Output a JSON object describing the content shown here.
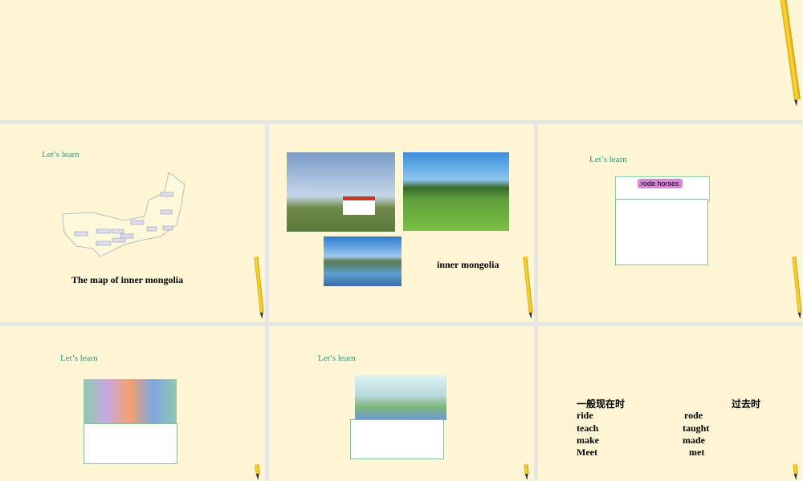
{
  "slides": [
    {
      "id": "slide-top"
    },
    {
      "lets_learn": "Let’s learn",
      "caption": "The map of inner mongolia"
    },
    {
      "caption": "inner mongolia"
    },
    {
      "lets_learn": "Let’s learn",
      "label": "rode horses"
    },
    {
      "lets_learn": "Let’s learn"
    },
    {
      "lets_learn": "Let’s learn"
    },
    {
      "table": {
        "header": [
          "一般现在时",
          "过去时"
        ],
        "rows": [
          [
            "ride",
            "rode"
          ],
          [
            "teach",
            "taught"
          ],
          [
            "make",
            "made"
          ],
          [
            "Meet",
            "met"
          ]
        ]
      }
    }
  ]
}
